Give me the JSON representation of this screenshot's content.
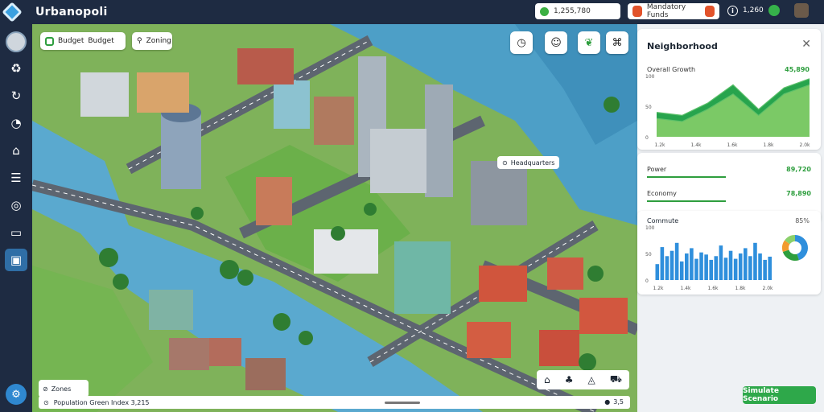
{
  "app": {
    "title": "Urbanopoli"
  },
  "topbar": {
    "resource_value": "1,255,780",
    "funds_label": "Mandatory Funds",
    "population_value": "1,260"
  },
  "sidebar": {
    "items": [
      {
        "icon": "recycle-icon"
      },
      {
        "icon": "refresh-icon"
      },
      {
        "icon": "speed-icon"
      },
      {
        "icon": "building-icon"
      },
      {
        "icon": "list-icon"
      },
      {
        "icon": "globe-icon"
      },
      {
        "icon": "chart-icon"
      },
      {
        "icon": "map-icon"
      }
    ],
    "bottom_icon": "settings-icon"
  },
  "map_controls": {
    "chip1_label": "Budget",
    "chip1_sub": "Budget",
    "chip2_label": "Zoning",
    "place_label": "Headquarters",
    "legend_label": "Zones",
    "bottom_text": "Population Green Index 3,215",
    "bottom_right": "3,5"
  },
  "panel": {
    "card1": {
      "title": "Neighborhood",
      "subtitle": "Overall Growth",
      "subtitle_value": "45,890"
    },
    "stats": [
      {
        "label": "Power",
        "value": "89,720",
        "fill": 0.48
      },
      {
        "label": "Economy",
        "value": "78,890",
        "fill": 0.48
      }
    ],
    "card3": {
      "title": "Commute",
      "title_value": "85%"
    },
    "simulate_button": "Simulate Scenario"
  },
  "chart_data": [
    {
      "type": "area",
      "categories": [
        "1.2k",
        "1.4k",
        "1.6k",
        "1.8k",
        "2.0k"
      ],
      "series": [
        {
          "values": [
            40,
            35,
            55,
            85,
            45,
            80,
            95
          ]
        },
        {
          "values": [
            30,
            25,
            45,
            70,
            35,
            70,
            85
          ]
        }
      ],
      "ylim": [
        0,
        100
      ],
      "yticks": [
        "100",
        "50",
        "0"
      ]
    },
    {
      "type": "bar",
      "categories": [
        "1.2k",
        "1.4k",
        "1.6k",
        "1.8k",
        "2.0k"
      ],
      "values": [
        30,
        62,
        45,
        55,
        70,
        35,
        50,
        60,
        40,
        52,
        48,
        38,
        45,
        65,
        42,
        55,
        40,
        50,
        60,
        45,
        70,
        50,
        38,
        44
      ],
      "ylim": [
        0,
        100
      ],
      "yticks": [
        "100",
        "50",
        "0"
      ],
      "pie": [
        {
          "value": 45,
          "color": "#2f8fdc"
        },
        {
          "value": 25,
          "color": "#2e9e3e"
        },
        {
          "value": 15,
          "color": "#f29a2e"
        },
        {
          "value": 15,
          "color": "#8bd06b"
        }
      ]
    }
  ],
  "colors": {
    "accent": "#2e9e3e",
    "bar": "#2f8fdc",
    "chart_area_dark": "#0f9a3a",
    "chart_area_light": "#8bd06b",
    "water": "#4d9fc7"
  }
}
